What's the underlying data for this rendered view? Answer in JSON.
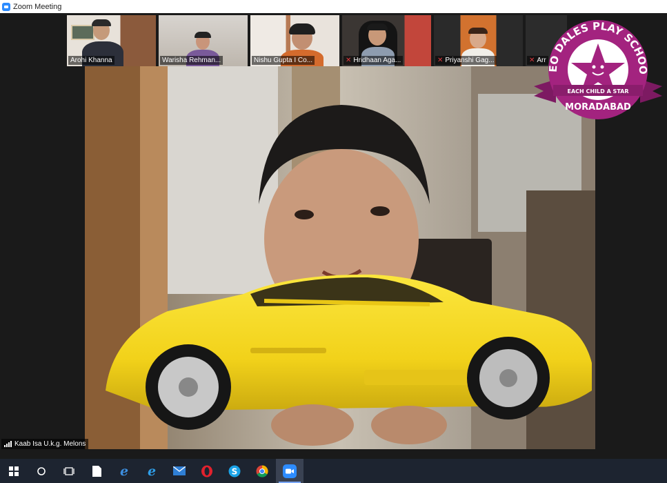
{
  "window": {
    "title": "Zoom Meeting"
  },
  "participants": [
    {
      "name": "Arohi Khanna",
      "muted": false
    },
    {
      "name": "Warisha Rehman...",
      "muted": false
    },
    {
      "name": "Nishu Gupta I Co...",
      "muted": false
    },
    {
      "name": "Hridhaan Aga...",
      "muted": true
    },
    {
      "name": "Priyanshi Gag...",
      "muted": true
    },
    {
      "name": "Arr",
      "muted": true
    }
  ],
  "active_speaker": {
    "name": "Kaab Isa U.k.g. Melons"
  },
  "school_badge": {
    "top_text": "NEO DALES PLAY SCHOOL",
    "tagline": "EACH CHILD A STAR",
    "city": "MORADABAD",
    "color": "#a3237f"
  },
  "taskbar": {
    "icons": [
      "windows-start-icon",
      "search-icon",
      "task-view-icon",
      "file-icon",
      "edge-legacy-icon",
      "edge-icon",
      "mail-icon",
      "opera-icon",
      "skype-icon",
      "chrome-icon",
      "zoom-icon"
    ],
    "active": "zoom-icon"
  },
  "colors": {
    "accent": "#2d8cff",
    "mute": "#e0393e",
    "car": "#f2d21a"
  }
}
